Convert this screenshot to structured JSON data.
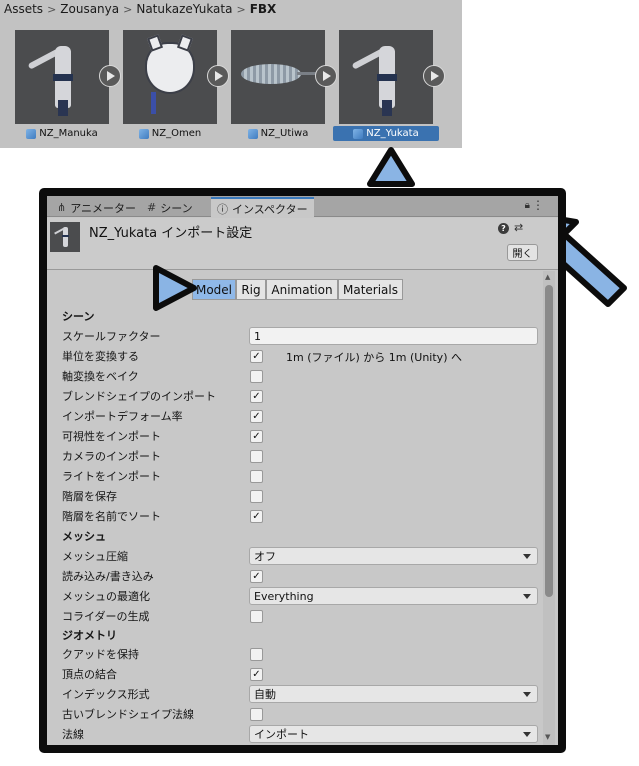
{
  "colors": {
    "accent": "#3a79bb",
    "selected_label": "#3a72b0",
    "active_toolbar_button": "#8fb8e8",
    "callout_fill": "#8ab4e4",
    "frame": "#0c0c0c"
  },
  "project": {
    "breadcrumb": [
      "Assets",
      "Zousanya",
      "NatukazeYukata",
      "FBX"
    ],
    "assets": [
      {
        "name": "NZ_Manuka",
        "selected": false
      },
      {
        "name": "NZ_Omen",
        "selected": false
      },
      {
        "name": "NZ_Utiwa",
        "selected": false
      },
      {
        "name": "NZ_Yukata",
        "selected": true
      }
    ]
  },
  "inspector": {
    "tabs": [
      "アニメーター",
      "シーン",
      "インスペクター"
    ],
    "title": "NZ_Yukata インポート設定",
    "open_label": "開く",
    "help_glyph": "?",
    "toolbar": [
      "Model",
      "Rig",
      "Animation",
      "Materials"
    ],
    "sections": {
      "scene": "シーン",
      "mesh": "メッシュ",
      "geometry": "ジオメトリ"
    },
    "props": {
      "scale_factor": {
        "label": "スケールファクター",
        "value": "1"
      },
      "convert_units": {
        "label": "単位を変換する",
        "checked": true,
        "note": "1m (ファイル) から 1m (Unity) へ"
      },
      "bake_axis": {
        "label": "軸変換をベイク",
        "checked": false
      },
      "import_blendshapes": {
        "label": "ブレンドシェイプのインポート",
        "checked": true
      },
      "import_deform_percent": {
        "label": "インポートデフォーム率",
        "checked": true
      },
      "import_visibility": {
        "label": "可視性をインポート",
        "checked": true
      },
      "import_cameras": {
        "label": "カメラのインポート",
        "checked": false
      },
      "import_lights": {
        "label": "ライトをインポート",
        "checked": false
      },
      "preserve_hierarchy": {
        "label": "階層を保存",
        "checked": false
      },
      "sort_hierarchy": {
        "label": "階層を名前でソート",
        "checked": true
      },
      "mesh_compression": {
        "label": "メッシュ圧縮",
        "value": "オフ"
      },
      "read_write": {
        "label": "読み込み/書き込み",
        "checked": true
      },
      "optimize_mesh": {
        "label": "メッシュの最適化",
        "value": "Everything"
      },
      "generate_colliders": {
        "label": "コライダーの生成",
        "checked": false
      },
      "keep_quads": {
        "label": "クアッドを保持",
        "checked": false
      },
      "weld_vertices": {
        "label": "頂点の結合",
        "checked": true
      },
      "index_format": {
        "label": "インデックス形式",
        "value": "自動"
      },
      "legacy_blendshape_normals": {
        "label": "古いブレンドシェイプ法線",
        "checked": false
      },
      "normals": {
        "label": "法線",
        "value": "インポート"
      }
    }
  }
}
